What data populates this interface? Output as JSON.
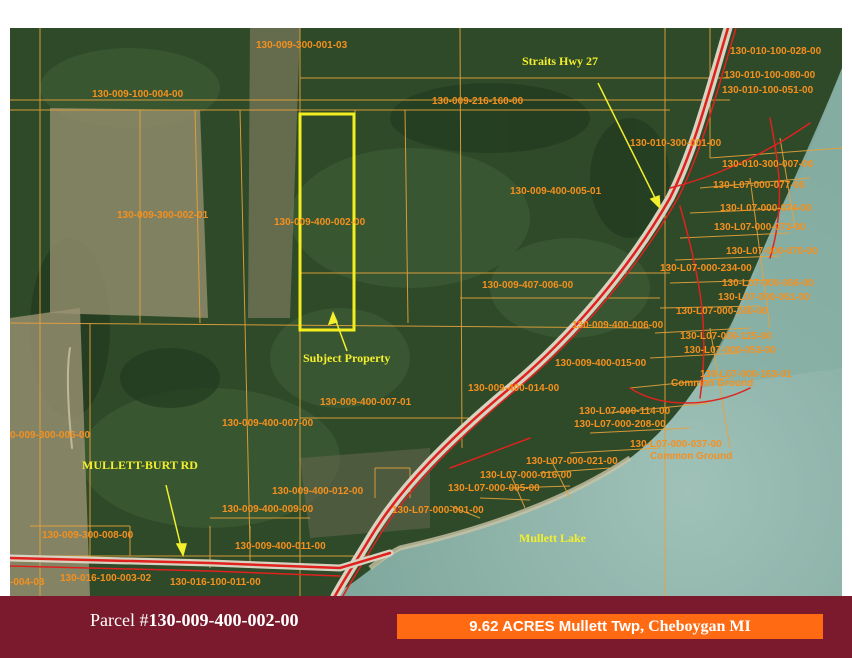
{
  "map": {
    "parcels": [
      {
        "id": "p1",
        "text": "130-009-300-001-03"
      },
      {
        "id": "p2",
        "text": "130-009-100-004-00"
      },
      {
        "id": "p3",
        "text": "130-009-216-160-00"
      },
      {
        "id": "p4",
        "text": "130-009-300-002-01"
      },
      {
        "id": "p5",
        "text": "130-009-400-002-00"
      },
      {
        "id": "p6",
        "text": "130-009-400-005-01"
      },
      {
        "id": "p7",
        "text": "130-009-407-006-00"
      },
      {
        "id": "p8",
        "text": "130-009-400-006-00"
      },
      {
        "id": "p9",
        "text": "130-009-400-015-00"
      },
      {
        "id": "p10",
        "text": "130-009-400-014-00"
      },
      {
        "id": "p11",
        "text": "130-009-400-007-01"
      },
      {
        "id": "p12",
        "text": "130-009-400-007-00"
      },
      {
        "id": "p13",
        "text": "0-009-300-006-00"
      },
      {
        "id": "p14",
        "text": "130-009-400-012-00"
      },
      {
        "id": "p15",
        "text": "130-009-400-009-00"
      },
      {
        "id": "p16",
        "text": "130-009-400-011-00"
      },
      {
        "id": "p17",
        "text": "130-009-300-008-00"
      },
      {
        "id": "p18",
        "text": "130-016-100-003-02"
      },
      {
        "id": "p19",
        "text": "130-016-100-011-00"
      },
      {
        "id": "p20",
        "text": "-004-03"
      },
      {
        "id": "p21",
        "text": "130-010-100-028-00"
      },
      {
        "id": "p22",
        "text": "130-010-100-080-00"
      },
      {
        "id": "p23",
        "text": "130-010-100-051-00"
      },
      {
        "id": "p24",
        "text": "130-010-300-001-00"
      },
      {
        "id": "p25",
        "text": "130-010-300-007-00"
      },
      {
        "id": "p26",
        "text": "130-L07-000-077-00"
      },
      {
        "id": "p27",
        "text": "130-L07-000-074-00"
      },
      {
        "id": "p28",
        "text": "130-L07-000-073-00"
      },
      {
        "id": "p29",
        "text": "130-L07-000-070-00"
      },
      {
        "id": "p30",
        "text": "130-L07-000-234-00"
      },
      {
        "id": "p31",
        "text": "130-L07-000-066-00"
      },
      {
        "id": "p32",
        "text": "130-L07-000-061-00"
      },
      {
        "id": "p33",
        "text": "130-L07-000-240-00"
      },
      {
        "id": "p34",
        "text": "130-L07-000-125-00"
      },
      {
        "id": "p35",
        "text": "130-L07-000-053-00"
      },
      {
        "id": "p36",
        "text": "130-L07-000-163-01"
      },
      {
        "id": "p37",
        "text": "130-L07-000-114-00"
      },
      {
        "id": "p38",
        "text": "130-L07-000-208-00"
      },
      {
        "id": "p39",
        "text": "130-L07-000-037-00"
      },
      {
        "id": "p40",
        "text": "130-L07-000-021-00"
      },
      {
        "id": "p41",
        "text": "130-L07-000-016-00"
      },
      {
        "id": "p42",
        "text": "130-L07-000-005-00"
      },
      {
        "id": "p43",
        "text": "130-L07-000-001-00"
      }
    ],
    "common_grounds": [
      "Common Ground",
      "Common Ground"
    ],
    "road_hwy_label": "Straits Hwy 27",
    "road_local_label": "MULLETT-BURT RD",
    "subject_label": "Subject Property",
    "lake_label": "Mullett Lake"
  },
  "footer": {
    "parcel_prefix": "Parcel #",
    "parcel_number": "130-009-400-002-00",
    "acreage_main": "9.62 ACRES Mullett Twp",
    "acreage_tail": ", Cheboygan MI"
  },
  "colors": {
    "parcel_line": "#e8a23a",
    "road": "#e0221f",
    "subject_outline": "#f4ee1e",
    "footer_bg": "#7a1a2c",
    "banner_bg": "#ff6a12"
  }
}
